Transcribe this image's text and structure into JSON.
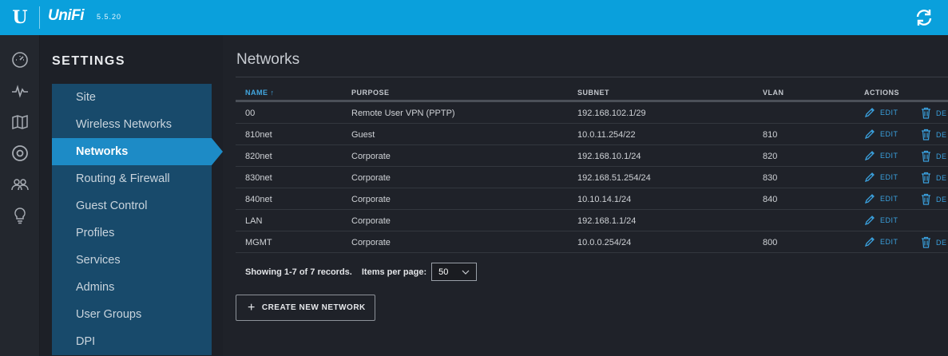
{
  "header": {
    "logo_letter": "U",
    "brand": "UniFi",
    "version": "5.5.20"
  },
  "sidebar_icons": [
    "dashboard-icon",
    "statistics-icon",
    "map-icon",
    "devices-icon",
    "clients-icon",
    "insights-icon"
  ],
  "settings": {
    "title": "SETTINGS",
    "items": [
      {
        "label": "Site"
      },
      {
        "label": "Wireless Networks"
      },
      {
        "label": "Networks"
      },
      {
        "label": "Routing & Firewall"
      },
      {
        "label": "Guest Control"
      },
      {
        "label": "Profiles"
      },
      {
        "label": "Services"
      },
      {
        "label": "Admins"
      },
      {
        "label": "User Groups"
      },
      {
        "label": "DPI"
      }
    ],
    "active_index": 2
  },
  "main": {
    "title": "Networks",
    "columns": {
      "name": "NAME",
      "purpose": "PURPOSE",
      "subnet": "SUBNET",
      "vlan": "VLAN",
      "actions": "ACTIONS"
    },
    "sort": {
      "column": "name",
      "direction": "ascending"
    },
    "edit_label": "EDIT",
    "delete_label": "DE",
    "rows": [
      {
        "name": "00",
        "purpose": "Remote User VPN (PPTP)",
        "subnet": "192.168.102.1/29",
        "vlan": "",
        "deletable": true
      },
      {
        "name": "810net",
        "purpose": "Guest",
        "subnet": "10.0.11.254/22",
        "vlan": "810",
        "deletable": true
      },
      {
        "name": "820net",
        "purpose": "Corporate",
        "subnet": "192.168.10.1/24",
        "vlan": "820",
        "deletable": true
      },
      {
        "name": "830net",
        "purpose": "Corporate",
        "subnet": "192.168.51.254/24",
        "vlan": "830",
        "deletable": true
      },
      {
        "name": "840net",
        "purpose": "Corporate",
        "subnet": "10.10.14.1/24",
        "vlan": "840",
        "deletable": true
      },
      {
        "name": "LAN",
        "purpose": "Corporate",
        "subnet": "192.168.1.1/24",
        "vlan": "",
        "deletable": false
      },
      {
        "name": "MGMT",
        "purpose": "Corporate",
        "subnet": "10.0.0.254/24",
        "vlan": "800",
        "deletable": true
      }
    ],
    "footer": {
      "showing": "Showing 1-7 of 7 records.",
      "items_per_page_label": "Items per page:",
      "items_per_page_value": "50"
    },
    "create_button": "CREATE NEW NETWORK"
  },
  "colors": {
    "accent": "#0aa0dc",
    "menu_bg": "#184a6b",
    "menu_active": "#1d8bc6",
    "link": "#3aa0dd"
  }
}
